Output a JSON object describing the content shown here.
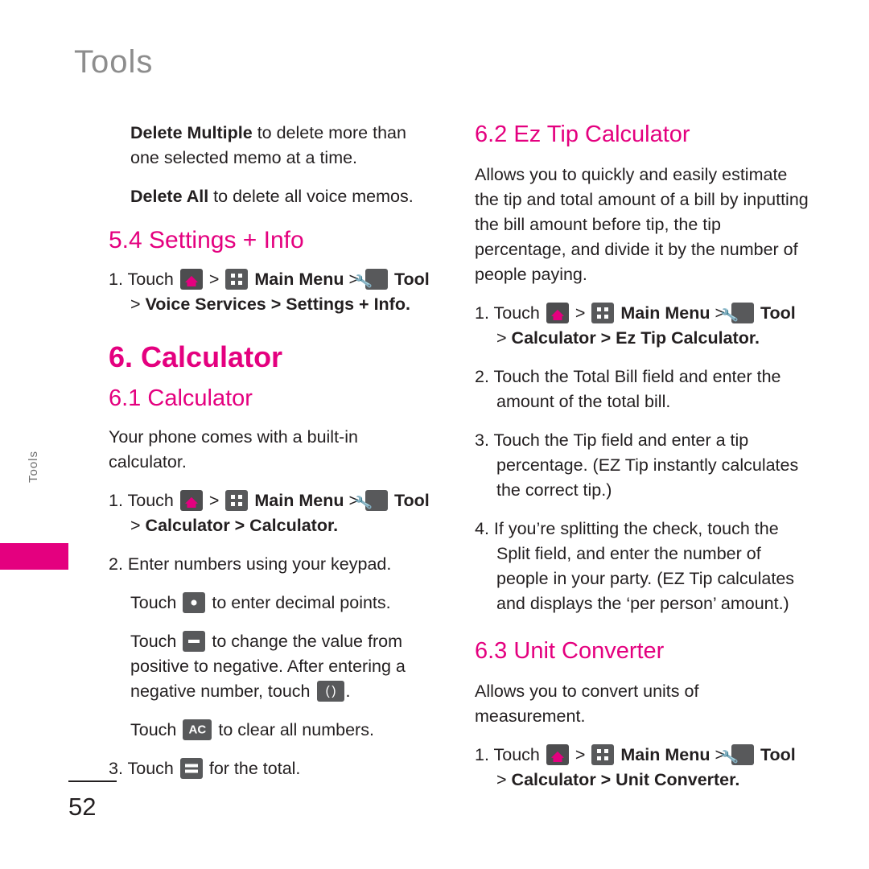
{
  "header": {
    "title": "Tools"
  },
  "side_tab": {
    "label": "Tools"
  },
  "footer": {
    "page_number": "52"
  },
  "icons": {
    "home": "home-key-icon",
    "menu": "main-menu-key-icon",
    "tool": "tool-key-icon",
    "dot": "decimal-point-key-icon",
    "minus": "minus-key-icon",
    "paren": "parenthesis-key-icon",
    "ac": "all-clear-key-icon",
    "equals": "equals-key-icon"
  },
  "left_column": {
    "para_delete_multiple_bold": "Delete Multiple",
    "para_delete_multiple_rest": " to delete more than one selected memo at a time.",
    "para_delete_all_bold": "Delete All",
    "para_delete_all_rest": " to delete all voice memos.",
    "section_5_4": "5.4 Settings + Info",
    "step_5_4_num": "1. Touch",
    "step_5_4_main_menu": "Main Menu",
    "step_5_4_tool": "Tool",
    "step_5_4_path": "Voice Services > Settings + Info.",
    "section_6": "6. Calculator",
    "section_6_1": "6.1 Calculator",
    "para_builtin": "Your phone comes with a built-in calculator.",
    "step_6_1_num": "1. Touch",
    "step_6_1_main_menu": "Main Menu",
    "step_6_1_tool": "Tool",
    "step_6_1_path": "Calculator > Calculator.",
    "step_6_1_2": "2. Enter numbers using your keypad.",
    "touch_dot_pre": "Touch",
    "touch_dot_post": "to enter decimal points.",
    "touch_minus_pre": "Touch",
    "touch_minus_post": "to change the value from positive to negative. After entering a negative number, touch",
    "touch_minus_end": ".",
    "touch_ac_pre": "Touch",
    "touch_ac_post": "to clear all numbers.",
    "step_6_1_3_pre": "3. Touch",
    "step_6_1_3_post": "for the total."
  },
  "right_column": {
    "section_6_2": "6.2 Ez Tip Calculator",
    "para_6_2": "Allows you to quickly and easily estimate the tip and total amount of a bill by inputting the bill amount before tip, the tip percentage, and divide it by the number of people paying.",
    "step_6_2_1_num": "1. Touch",
    "step_6_2_1_main_menu": "Main Menu",
    "step_6_2_1_tool": "Tool",
    "step_6_2_1_path": "Calculator > Ez Tip Calculator.",
    "step_6_2_2": "2. Touch the Total Bill field and enter the amount of the total bill.",
    "step_6_2_3": "3. Touch the Tip field and enter a tip percentage. (EZ Tip instantly calculates the correct tip.)",
    "step_6_2_4": "4. If you’re splitting the check, touch the Split field, and enter the number of people in your party. (EZ Tip calculates and displays the ‘per person’ amount.)",
    "section_6_3": "6.3 Unit Converter",
    "para_6_3": "Allows you to convert units of measurement.",
    "step_6_3_1_num": "1. Touch",
    "step_6_3_1_main_menu": "Main Menu",
    "step_6_3_1_tool": "Tool",
    "step_6_3_1_path": "Calculator > Unit Converter."
  }
}
